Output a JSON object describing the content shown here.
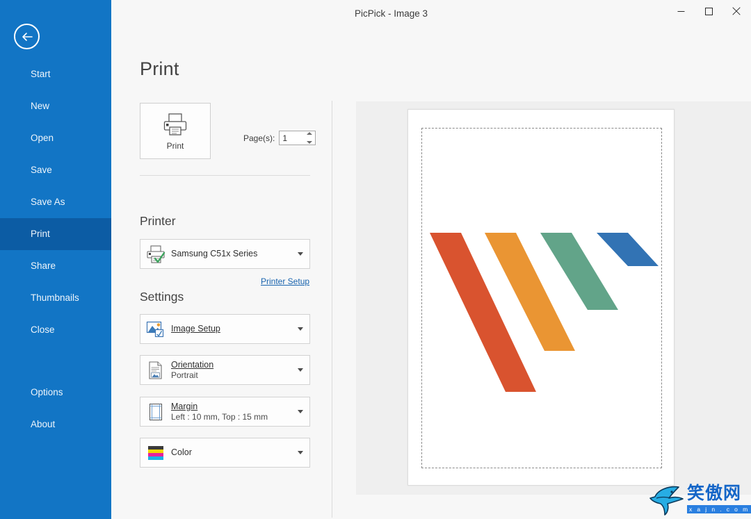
{
  "window": {
    "title": "PicPick - Image 3",
    "minimize_label": "Minimize",
    "maximize_label": "Maximize",
    "close_label": "Close"
  },
  "sidebar": {
    "back_label": "Back",
    "items": [
      {
        "label": "Start",
        "selected": false
      },
      {
        "label": "New",
        "selected": false
      },
      {
        "label": "Open",
        "selected": false
      },
      {
        "label": "Save",
        "selected": false
      },
      {
        "label": "Save As",
        "selected": false
      },
      {
        "label": "Print",
        "selected": true
      },
      {
        "label": "Share",
        "selected": false
      },
      {
        "label": "Thumbnails",
        "selected": false
      },
      {
        "label": "Close",
        "selected": false
      }
    ],
    "footer_items": [
      {
        "label": "Options"
      },
      {
        "label": "About"
      }
    ],
    "colors": {
      "background": "#1275c5",
      "selected": "#0c5ca4",
      "text": "#eef5fb"
    }
  },
  "main": {
    "page_title": "Print",
    "print_button": {
      "label": "Print",
      "icon": "printer-icon"
    },
    "pages": {
      "label": "Page(s):",
      "value": "1",
      "placeholder": "1"
    },
    "printer_section": {
      "heading": "Printer",
      "selected_printer": "Samsung C51x Series",
      "icon": "printer-ready-icon",
      "setup_link": "Printer Setup"
    },
    "settings_section": {
      "heading": "Settings",
      "items": [
        {
          "name": "image-setup",
          "icon": "image-setup-icon",
          "title": "Image Setup",
          "accelerator": "I",
          "value": ""
        },
        {
          "name": "orientation",
          "icon": "orientation-icon",
          "title": "Orientation",
          "accelerator": "O",
          "value": "Portrait"
        },
        {
          "name": "margin",
          "icon": "margin-icon",
          "title": "Margin",
          "accelerator": "M",
          "value": "Left : 10 mm, Top : 15 mm"
        },
        {
          "name": "color",
          "icon": "cmyk-color-icon",
          "title": "Color",
          "accelerator": "",
          "value": ""
        }
      ]
    }
  },
  "preview": {
    "name": "print-preview",
    "paper_orientation": "Portrait",
    "margin_guide": "dashed",
    "artwork": {
      "description": "Four slanted parallelogram bars of decreasing length",
      "bars": [
        {
          "color": "#d9532f",
          "name": "bar-red"
        },
        {
          "color": "#ea9533",
          "name": "bar-orange"
        },
        {
          "color": "#62a489",
          "name": "bar-green"
        },
        {
          "color": "#3273b4",
          "name": "bar-blue"
        }
      ]
    }
  },
  "watermark": {
    "text": "笑傲网",
    "url": "x a j n . c o m",
    "logo": "shark-logo"
  },
  "colors": {
    "accent": "#1275c5",
    "link": "#1763ae",
    "surface": "#f7f7f7",
    "preview_bg": "#efefef"
  }
}
